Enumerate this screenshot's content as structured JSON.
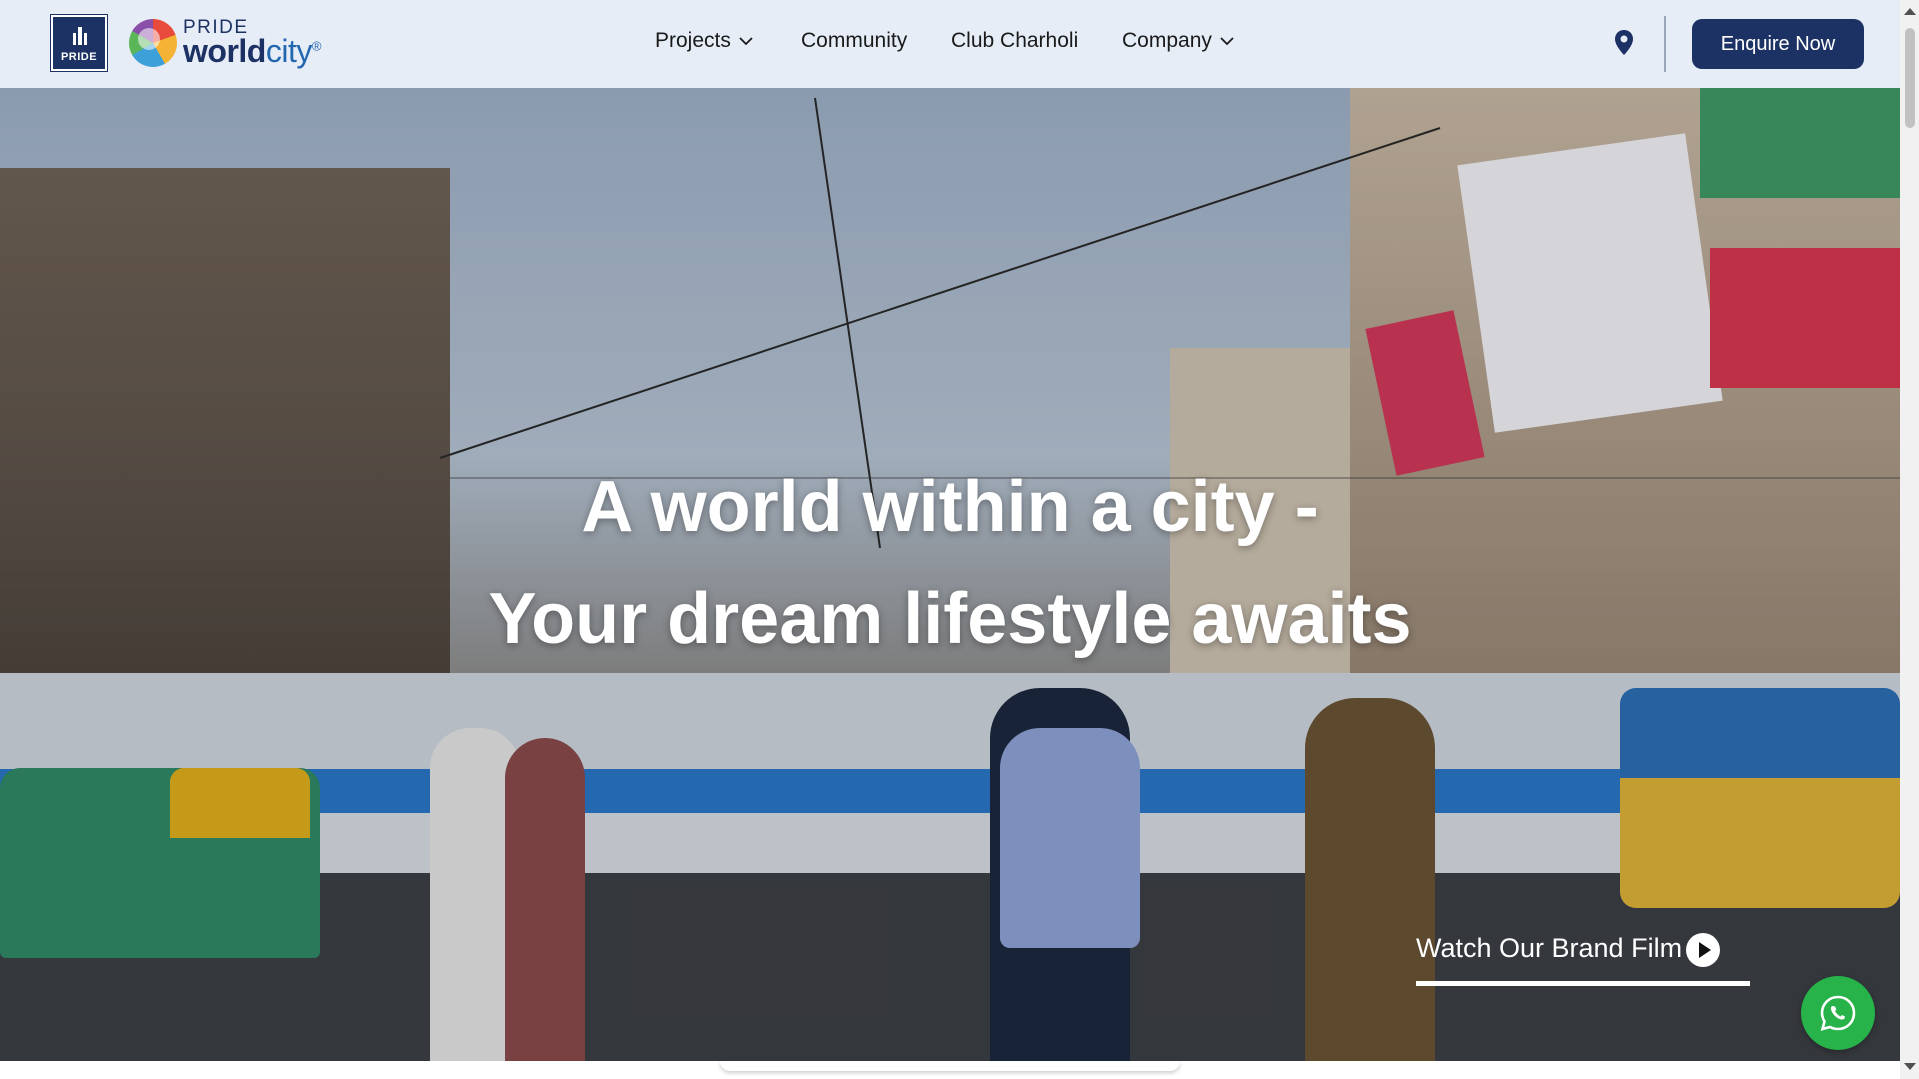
{
  "header": {
    "logo": {
      "mark_label": "PRIDE",
      "small_text": "PRIDE",
      "world": "world",
      "city": "city",
      "registered": "®"
    },
    "nav": [
      {
        "label": "Projects",
        "has_dropdown": true
      },
      {
        "label": "Community",
        "has_dropdown": false
      },
      {
        "label": "Club Charholi",
        "has_dropdown": false
      },
      {
        "label": "Company",
        "has_dropdown": true
      }
    ],
    "location_icon": "map-pin-icon",
    "enquire_label": "Enquire Now"
  },
  "hero": {
    "title_line1": "A world within a city -",
    "title_line2": "Your dream lifestyle awaits",
    "brand_film_label": "Watch Our Brand Film",
    "brand_film_icon": "play-circle-icon"
  },
  "floating": {
    "whatsapp_icon": "whatsapp-icon"
  },
  "colors": {
    "navy": "#1d3264",
    "header_bg": "#e6edf7",
    "whatsapp_green": "#27b24a",
    "logo_blue": "#2267b0"
  }
}
